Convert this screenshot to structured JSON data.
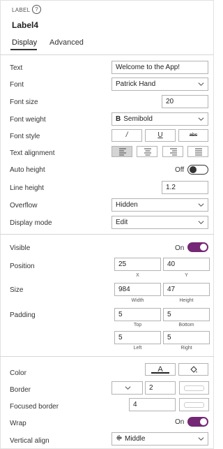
{
  "header": {
    "type_label": "LABEL",
    "control_name": "Label4"
  },
  "tabs": [
    {
      "label": "Display",
      "active": true
    },
    {
      "label": "Advanced",
      "active": false
    }
  ],
  "display": {
    "text": {
      "label": "Text",
      "value": "Welcome to the App!"
    },
    "font": {
      "label": "Font",
      "value": "Patrick Hand"
    },
    "font_size": {
      "label": "Font size",
      "value": "20"
    },
    "font_weight": {
      "label": "Font weight",
      "value": "Semibold",
      "icon_glyph": "B"
    },
    "font_style": {
      "label": "Font style",
      "buttons": [
        "/",
        "U",
        "abc"
      ]
    },
    "text_alignment": {
      "label": "Text alignment",
      "selected": "left"
    },
    "auto_height": {
      "label": "Auto height",
      "state": "Off"
    },
    "line_height": {
      "label": "Line height",
      "value": "1.2"
    },
    "overflow": {
      "label": "Overflow",
      "value": "Hidden"
    },
    "display_mode": {
      "label": "Display mode",
      "value": "Edit"
    }
  },
  "layout": {
    "visible": {
      "label": "Visible",
      "state": "On"
    },
    "position": {
      "label": "Position",
      "x": "25",
      "y": "40",
      "x_caption": "X",
      "y_caption": "Y"
    },
    "size": {
      "label": "Size",
      "width": "984",
      "height": "47",
      "width_caption": "Width",
      "height_caption": "Height"
    },
    "padding": {
      "label": "Padding",
      "top": "5",
      "bottom": "5",
      "left": "5",
      "right": "5",
      "top_caption": "Top",
      "bottom_caption": "Bottom",
      "left_caption": "Left",
      "right_caption": "Right"
    }
  },
  "style": {
    "color": {
      "label": "Color",
      "text_glyph": "A"
    },
    "border": {
      "label": "Border",
      "value": "2"
    },
    "focused_border": {
      "label": "Focused border",
      "value": "4"
    },
    "wrap": {
      "label": "Wrap",
      "state": "On"
    },
    "vertical_align": {
      "label": "Vertical align",
      "value": "Middle"
    }
  },
  "colors": {
    "accent": "#742774",
    "toggle_off": "#333333",
    "selected_seg": "#d4d4d4"
  }
}
